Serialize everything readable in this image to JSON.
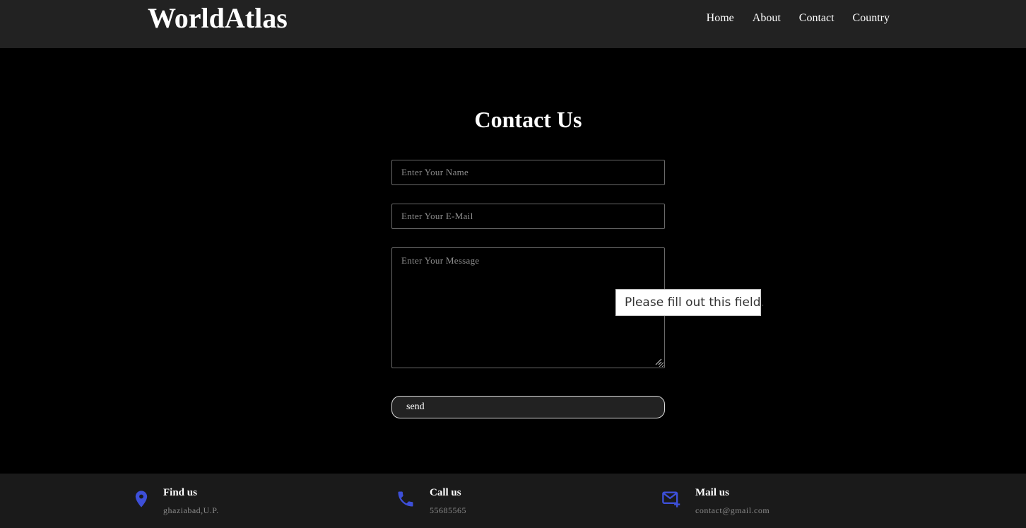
{
  "header": {
    "logo": "WorldAtlas",
    "nav": [
      {
        "label": "Home"
      },
      {
        "label": "About"
      },
      {
        "label": "Contact"
      },
      {
        "label": "Country"
      }
    ]
  },
  "main": {
    "title": "Contact Us",
    "form": {
      "name_placeholder": "Enter Your Name",
      "email_placeholder": "Enter Your E-Mail",
      "message_placeholder": "Enter Your Message",
      "send_label": "send"
    },
    "validation_tooltip": "Please fill out this field."
  },
  "footer": {
    "items": [
      {
        "heading": "Find us",
        "text": "ghaziabad,U.P.",
        "icon": "location-pin-icon"
      },
      {
        "heading": "Call us",
        "text": "55685565",
        "icon": "phone-icon"
      },
      {
        "heading": "Mail us",
        "text": "contact@gmail.com",
        "icon": "mail-add-icon"
      }
    ]
  },
  "colors": {
    "header_bg": "#222222",
    "page_bg": "#000000",
    "footer_bg": "#1a1a1a",
    "icon_accent": "#3d4fd8"
  }
}
